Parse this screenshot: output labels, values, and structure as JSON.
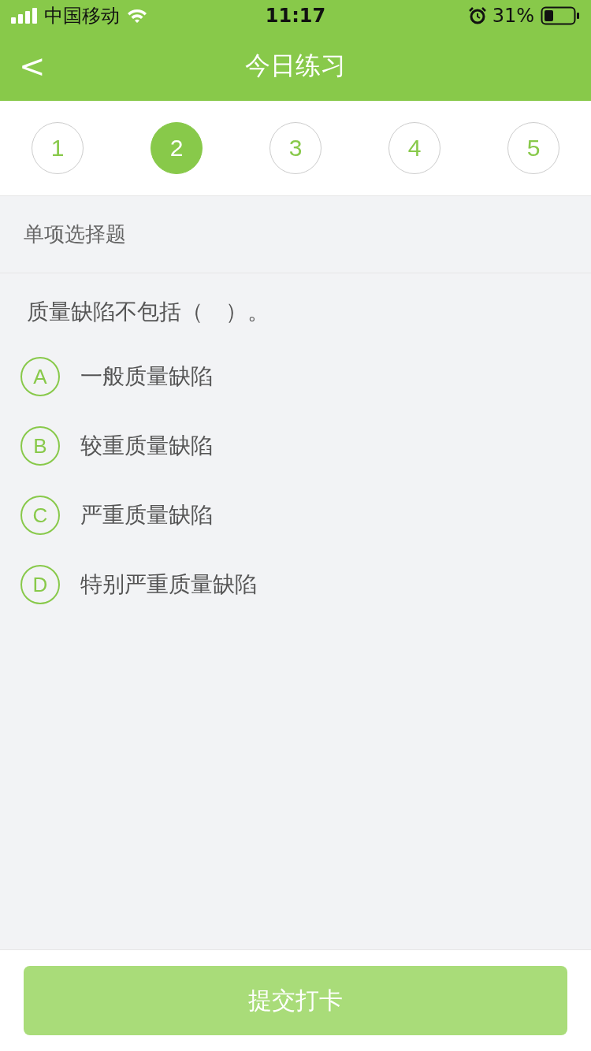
{
  "status_bar": {
    "carrier": "中国移动",
    "time": "11:17",
    "battery": "31%"
  },
  "nav_bar": {
    "back_icon": "<",
    "title": "今日练习"
  },
  "question_tabs": [
    {
      "label": "1",
      "selected": false
    },
    {
      "label": "2",
      "selected": true
    },
    {
      "label": "3",
      "selected": false
    },
    {
      "label": "4",
      "selected": false
    },
    {
      "label": "5",
      "selected": false
    }
  ],
  "section": {
    "title": "单项选择题"
  },
  "question": {
    "text": "质量缺陷不包括（　）。",
    "options": [
      {
        "letter": "A",
        "text": "一般质量缺陷",
        "selected": false
      },
      {
        "letter": "B",
        "text": "较重质量缺陷",
        "selected": false
      },
      {
        "letter": "C",
        "text": "严重质量缺陷",
        "selected": false
      },
      {
        "letter": "D",
        "text": "特别严重质量缺陷",
        "selected": false
      }
    ]
  },
  "submit_button": {
    "label": "提交打卡",
    "disabled": true
  }
}
